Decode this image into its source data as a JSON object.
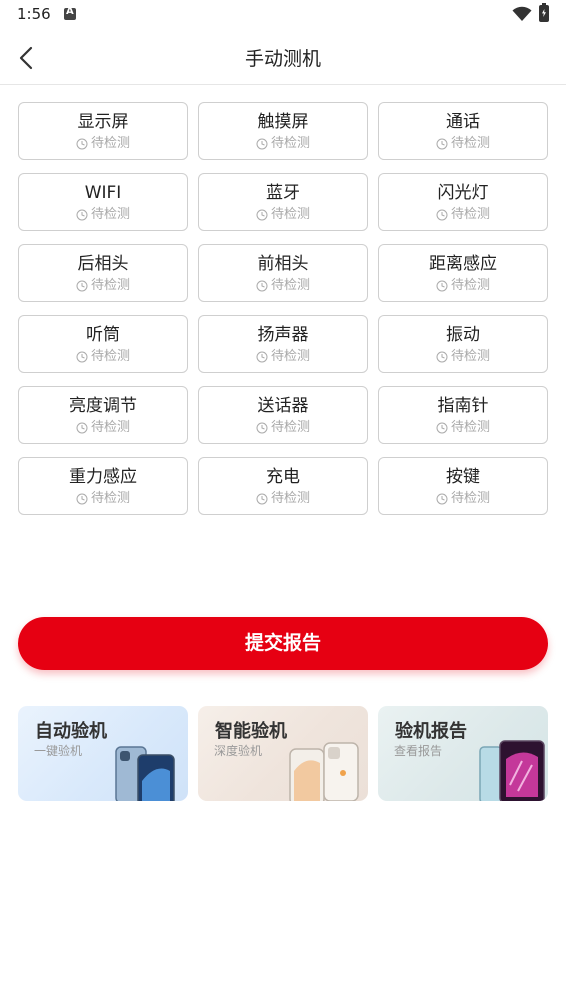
{
  "status": {
    "time": "1:56"
  },
  "header": {
    "title": "手动测机",
    "back_icon": "chevron-left-icon"
  },
  "tests": [
    {
      "name": "显示屏",
      "status": "待检测"
    },
    {
      "name": "触摸屏",
      "status": "待检测"
    },
    {
      "name": "通话",
      "status": "待检测"
    },
    {
      "name": "WIFI",
      "status": "待检测"
    },
    {
      "name": "蓝牙",
      "status": "待检测"
    },
    {
      "name": "闪光灯",
      "status": "待检测"
    },
    {
      "name": "后相头",
      "status": "待检测"
    },
    {
      "name": "前相头",
      "status": "待检测"
    },
    {
      "name": "距离感应",
      "status": "待检测"
    },
    {
      "name": "听筒",
      "status": "待检测"
    },
    {
      "name": "扬声器",
      "status": "待检测"
    },
    {
      "name": "振动",
      "status": "待检测"
    },
    {
      "name": "亮度调节",
      "status": "待检测"
    },
    {
      "name": "送话器",
      "status": "待检测"
    },
    {
      "name": "指南针",
      "status": "待检测"
    },
    {
      "name": "重力感应",
      "status": "待检测"
    },
    {
      "name": "充电",
      "status": "待检测"
    },
    {
      "name": "按键",
      "status": "待检测"
    }
  ],
  "submit": {
    "label": "提交报告",
    "color": "#e60012"
  },
  "cards": [
    {
      "title": "自动验机",
      "subtitle": "一键验机"
    },
    {
      "title": "智能验机",
      "subtitle": "深度验机"
    },
    {
      "title": "验机报告",
      "subtitle": "查看报告"
    }
  ]
}
